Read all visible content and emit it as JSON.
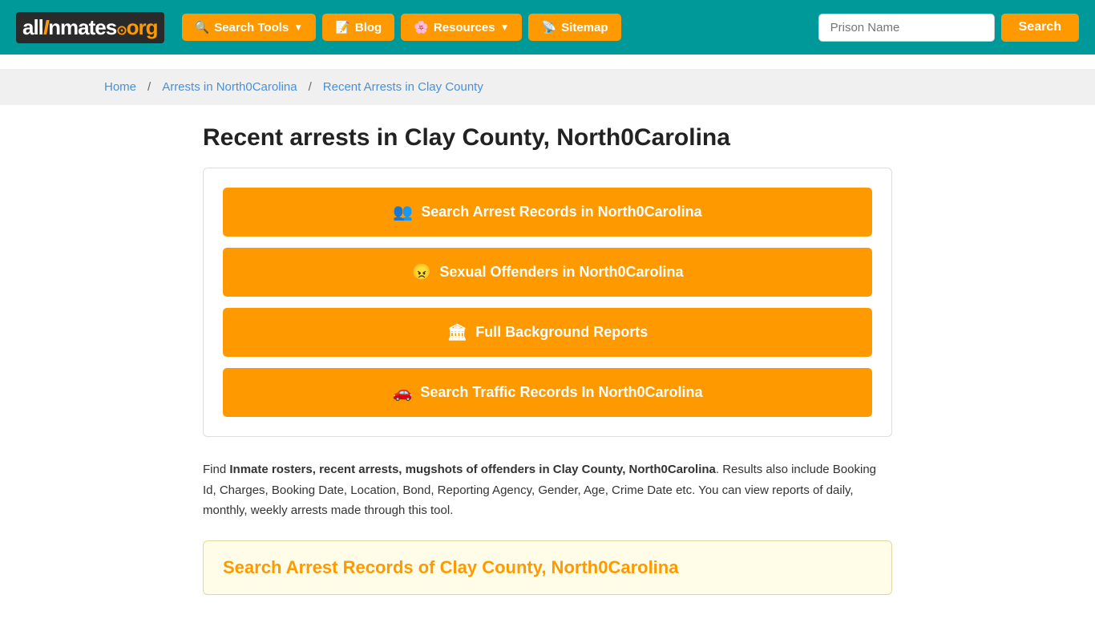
{
  "header": {
    "logo": {
      "part1": "all",
      "part2": "I",
      "part3": "nmates",
      "dot": "⊙",
      "org": "org"
    },
    "nav": [
      {
        "label": "Search Tools",
        "icon": "🔍",
        "has_arrow": true
      },
      {
        "label": "Blog",
        "icon": "📝",
        "has_arrow": false
      },
      {
        "label": "Resources",
        "icon": "🌸",
        "has_arrow": true
      },
      {
        "label": "Sitemap",
        "icon": "📡",
        "has_arrow": false
      }
    ],
    "search_placeholder": "Prison Name",
    "search_button": "Search"
  },
  "breadcrumb": {
    "items": [
      {
        "label": "Home",
        "href": "#"
      },
      {
        "label": "Arrests in North0Carolina",
        "href": "#"
      },
      {
        "label": "Recent Arrests in Clay County",
        "href": "#"
      }
    ]
  },
  "page": {
    "title": "Recent arrests in Clay County, North0Carolina",
    "buttons": [
      {
        "icon": "👥",
        "label": "Search Arrest Records in North0Carolina"
      },
      {
        "icon": "😠",
        "label": "Sexual Offenders in North0Carolina"
      },
      {
        "icon": "🏛",
        "label": "Full Background Reports"
      },
      {
        "icon": "🚗",
        "label": "Search Traffic Records In North0Carolina"
      }
    ],
    "description_prefix": "Find ",
    "description_bold": "Inmate rosters, recent arrests, mugshots of offenders in Clay County, North0Carolina",
    "description_suffix": ". Results also include Booking Id, Charges, Booking Date, Location, Bond, Reporting Agency, Gender, Age, Crime Date etc. You can view reports of daily, monthly, weekly arrests made through this tool.",
    "arrest_records_title": "Search Arrest Records of Clay County, North0Carolina"
  }
}
